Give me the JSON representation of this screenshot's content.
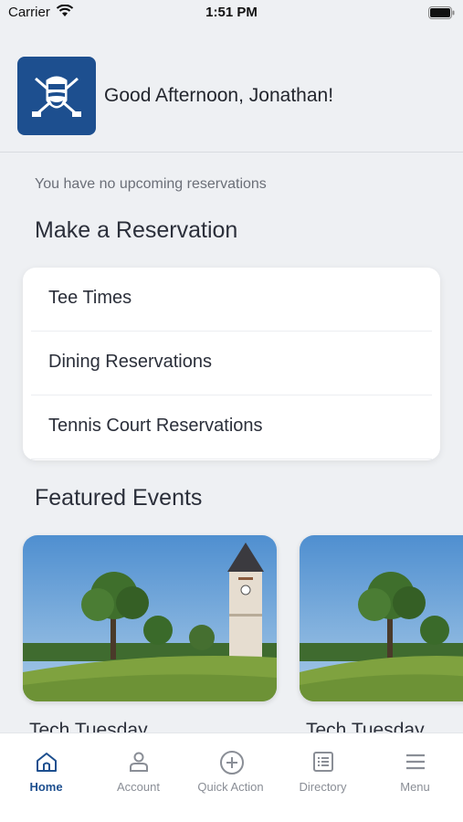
{
  "status_bar": {
    "carrier": "Carrier",
    "time": "1:51 PM"
  },
  "header": {
    "greeting": "Good Afternoon, Jonathan!",
    "logo_icon": "club-crest-icon"
  },
  "reservations": {
    "empty_message": "You have no upcoming reservations",
    "section_title": "Make a Reservation",
    "items": [
      {
        "label": "Tee Times"
      },
      {
        "label": "Dining Reservations"
      },
      {
        "label": "Tennis Court Reservations"
      }
    ]
  },
  "events": {
    "section_title": "Featured Events",
    "items": [
      {
        "title": "Tech Tuesday"
      },
      {
        "title": "Tech Tuesday"
      }
    ]
  },
  "tab_bar": {
    "tabs": [
      {
        "label": "Home",
        "icon": "home-icon",
        "active": true
      },
      {
        "label": "Account",
        "icon": "person-icon",
        "active": false
      },
      {
        "label": "Quick Action",
        "icon": "plus-circle-icon",
        "active": false
      },
      {
        "label": "Directory",
        "icon": "list-icon",
        "active": false
      },
      {
        "label": "Menu",
        "icon": "hamburger-icon",
        "active": false
      }
    ]
  },
  "colors": {
    "accent": "#1d4f8f",
    "background": "#eef0f3",
    "inactive": "#8a8e96"
  }
}
